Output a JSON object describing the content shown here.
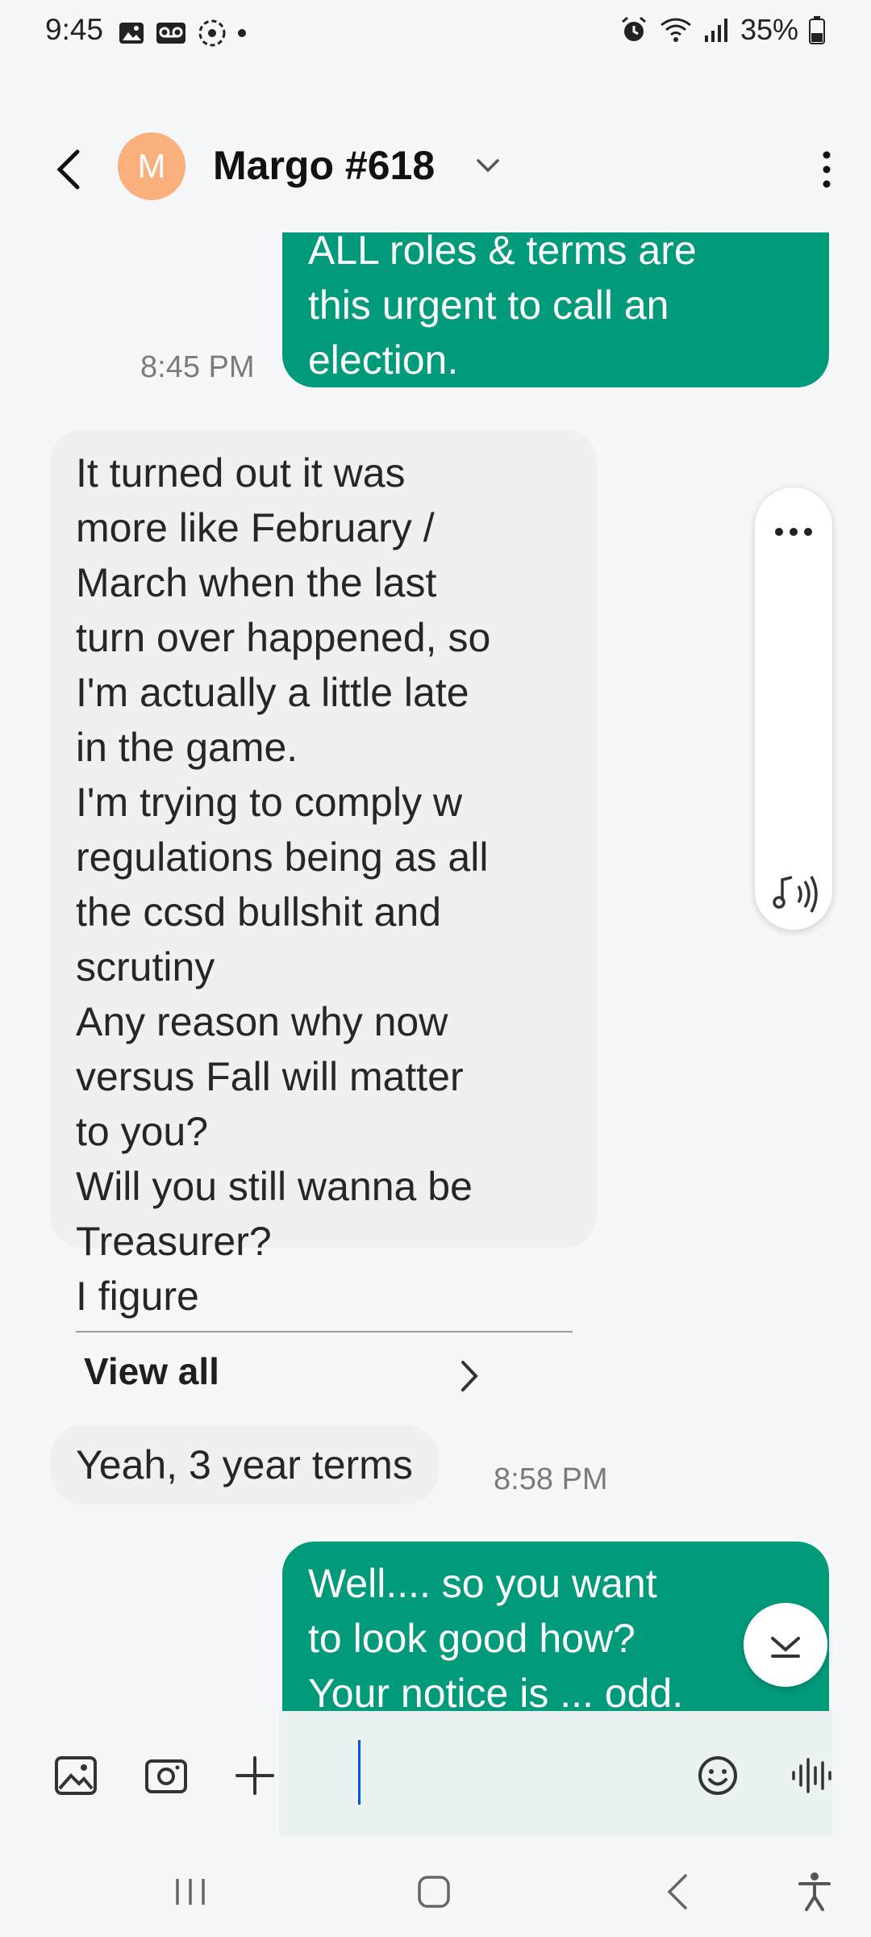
{
  "status_bar": {
    "time": "9:45",
    "battery": "35%"
  },
  "header": {
    "avatar_initial": "M",
    "contact_name": "Margo #618"
  },
  "messages": [
    {
      "direction": "outgoing",
      "text_lines": [
        "ALL roles & terms are",
        "this urgent to call an",
        "election."
      ],
      "time": "8:45 PM"
    },
    {
      "direction": "incoming",
      "text_lines": [
        "It turned out it was",
        "more like February /",
        "March when the last",
        "turn over happened, so",
        "I'm actually a little late",
        "in the game.",
        "I'm trying to comply w",
        "regulations being as all",
        "the ccsd bullshit and",
        "scrutiny",
        "Any reason why now",
        "versus Fall will matter",
        "to you?",
        "Will you still wanna be",
        "Treasurer?",
        "I figure"
      ],
      "view_all_label": "View all"
    },
    {
      "direction": "incoming",
      "text": "Yeah, 3 year terms",
      "time": "8:58 PM"
    },
    {
      "direction": "outgoing",
      "text_lines": [
        "Well.... so you want",
        "to look good how?",
        "Your notice is ... odd."
      ]
    }
  ],
  "composer": {
    "value": "",
    "placeholder": ""
  },
  "colors": {
    "outgoing_bubble": "#019b7c",
    "incoming_bubble": "#f0f0f1",
    "avatar": "#f9b07c"
  }
}
